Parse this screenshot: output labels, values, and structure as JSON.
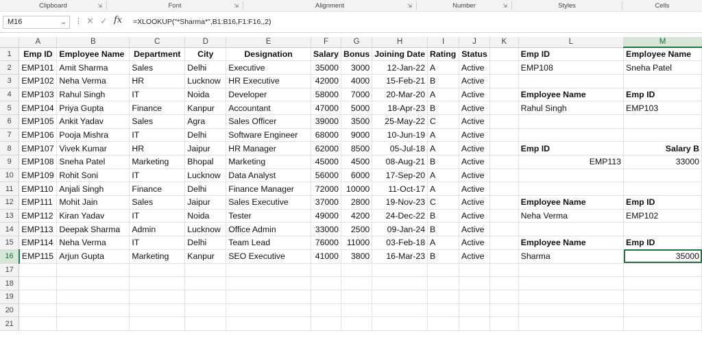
{
  "ribbon": {
    "groups": [
      "Clipboard",
      "Font",
      "Alignment",
      "Number",
      "Styles",
      "Cells"
    ]
  },
  "formula_bar": {
    "name_box": "M16",
    "fx_label": "fx",
    "formula": "=XLOOKUP(\"*Sharma*\",B1:B16,F1:F16,,2)"
  },
  "sheet": {
    "columns": [
      "A",
      "B",
      "C",
      "D",
      "E",
      "F",
      "G",
      "H",
      "I",
      "J",
      "K",
      "L",
      "M"
    ],
    "active_cell": "M16",
    "rows": [
      [
        "1",
        "Emp ID",
        "Employee Name",
        "Department",
        "City",
        "Designation",
        "Salary",
        "Bonus",
        "Joining Date",
        "Rating",
        "Status",
        "",
        "Emp ID",
        "Employee Name"
      ],
      [
        "2",
        "EMP101",
        "Amit Sharma",
        "Sales",
        "Delhi",
        "Executive",
        "35000",
        "3000",
        "12-Jan-22",
        "A",
        "Active",
        "",
        "EMP108",
        "Sneha Patel"
      ],
      [
        "3",
        "EMP102",
        "Neha Verma",
        "HR",
        "Lucknow",
        "HR Executive",
        "42000",
        "4000",
        "15-Feb-21",
        "B",
        "Active",
        "",
        "",
        ""
      ],
      [
        "4",
        "EMP103",
        "Rahul Singh",
        "IT",
        "Noida",
        "Developer",
        "58000",
        "7000",
        "20-Mar-20",
        "A",
        "Active",
        "",
        "Employee Name",
        "Emp ID"
      ],
      [
        "5",
        "EMP104",
        "Priya Gupta",
        "Finance",
        "Kanpur",
        "Accountant",
        "47000",
        "5000",
        "18-Apr-23",
        "B",
        "Active",
        "",
        "Rahul Singh",
        "EMP103"
      ],
      [
        "6",
        "EMP105",
        "Ankit Yadav",
        "Sales",
        "Agra",
        "Sales Officer",
        "39000",
        "3500",
        "25-May-22",
        "C",
        "Active",
        "",
        "",
        ""
      ],
      [
        "7",
        "EMP106",
        "Pooja Mishra",
        "IT",
        "Delhi",
        "Software Engineer",
        "68000",
        "9000",
        "10-Jun-19",
        "A",
        "Active",
        "",
        "",
        ""
      ],
      [
        "8",
        "EMP107",
        "Vivek Kumar",
        "HR",
        "Jaipur",
        "HR Manager",
        "62000",
        "8500",
        "05-Jul-18",
        "A",
        "Active",
        "",
        "Emp ID",
        "Salary  B"
      ],
      [
        "9",
        "EMP108",
        "Sneha Patel",
        "Marketing",
        "Bhopal",
        "Marketing",
        "45000",
        "4500",
        "08-Aug-21",
        "B",
        "Active",
        "",
        "EMP113",
        "33000"
      ],
      [
        "10",
        "EMP109",
        "Rohit Soni",
        "IT",
        "Lucknow",
        "Data Analyst",
        "56000",
        "6000",
        "17-Sep-20",
        "A",
        "Active",
        "",
        "",
        ""
      ],
      [
        "11",
        "EMP110",
        "Anjali Singh",
        "Finance",
        "Delhi",
        "Finance Manager",
        "72000",
        "10000",
        "11-Oct-17",
        "A",
        "Active",
        "",
        "",
        ""
      ],
      [
        "12",
        "EMP111",
        "Mohit Jain",
        "Sales",
        "Jaipur",
        "Sales Executive",
        "37000",
        "2800",
        "19-Nov-23",
        "C",
        "Active",
        "",
        "Employee Name",
        "Emp ID"
      ],
      [
        "13",
        "EMP112",
        "Kiran Yadav",
        "IT",
        "Noida",
        "Tester",
        "49000",
        "4200",
        "24-Dec-22",
        "B",
        "Active",
        "",
        "Neha Verma",
        "EMP102"
      ],
      [
        "14",
        "EMP113",
        "Deepak Sharma",
        "Admin",
        "Lucknow",
        "Office Admin",
        "33000",
        "2500",
        "09-Jan-24",
        "B",
        "Active",
        "",
        "",
        ""
      ],
      [
        "15",
        "EMP114",
        "Neha Verma",
        "IT",
        "Delhi",
        "Team Lead",
        "76000",
        "11000",
        "03-Feb-18",
        "A",
        "Active",
        "",
        "Employee Name",
        "Emp ID"
      ],
      [
        "16",
        "EMP115",
        "Arjun Gupta",
        "Marketing",
        "Kanpur",
        "SEO Executive",
        "41000",
        "3800",
        "16-Mar-23",
        "B",
        "Active",
        "",
        "Sharma",
        "35000"
      ],
      [
        "17",
        "",
        "",
        "",
        "",
        "",
        "",
        "",
        "",
        "",
        "",
        "",
        "",
        ""
      ],
      [
        "18",
        "",
        "",
        "",
        "",
        "",
        "",
        "",
        "",
        "",
        "",
        "",
        "",
        ""
      ],
      [
        "19",
        "",
        "",
        "",
        "",
        "",
        "",
        "",
        "",
        "",
        "",
        "",
        "",
        ""
      ],
      [
        "20",
        "",
        "",
        "",
        "",
        "",
        "",
        "",
        "",
        "",
        "",
        "",
        "",
        ""
      ],
      [
        "21",
        "",
        "",
        "",
        "",
        "",
        "",
        "",
        "",
        "",
        "",
        "",
        "",
        ""
      ]
    ]
  }
}
